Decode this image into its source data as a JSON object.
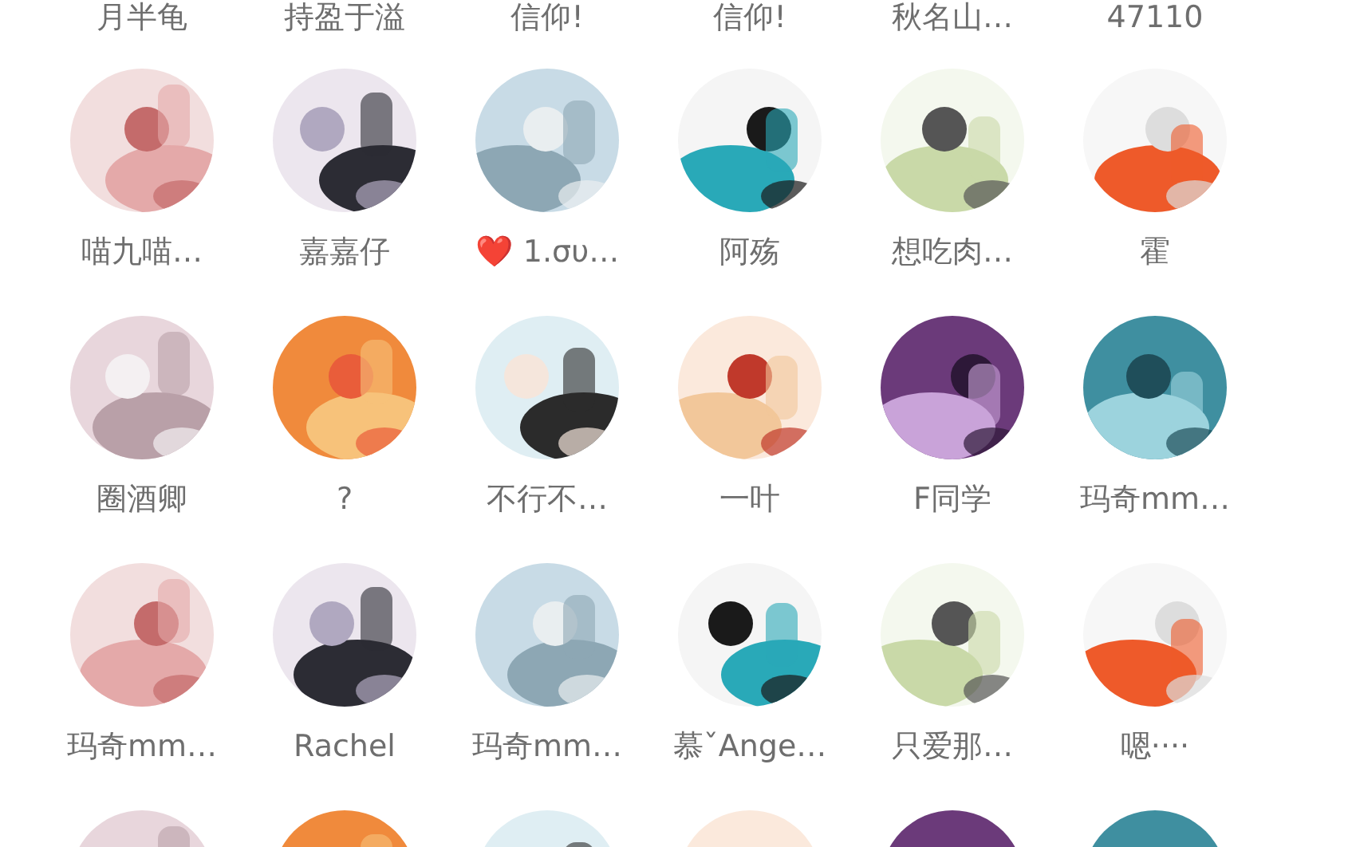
{
  "friends": [
    {
      "name": "月半龟"
    },
    {
      "name": "持盈于溢"
    },
    {
      "name": "信仰!"
    },
    {
      "name": "信仰!"
    },
    {
      "name": "秋名山…"
    },
    {
      "name": "47110"
    },
    {
      "name": "喵九喵…",
      "avatar": {
        "kind": "picture"
      }
    },
    {
      "name": "嘉嘉仔",
      "avatar": {
        "kind": "picture"
      }
    },
    {
      "name": "❤️ 1.συ…",
      "avatar": {
        "kind": "picture"
      }
    },
    {
      "name": "阿殇",
      "avatar": {
        "kind": "picture"
      }
    },
    {
      "name": "想吃肉…",
      "avatar": {
        "kind": "picture"
      }
    },
    {
      "name": "霍",
      "avatar": {
        "kind": "picture"
      }
    },
    {
      "name": "圈酒卿",
      "avatar": {
        "kind": "picture"
      }
    },
    {
      "name": "?",
      "avatar": {
        "kind": "picture"
      }
    },
    {
      "name": "不行不…",
      "avatar": {
        "kind": "picture"
      }
    },
    {
      "name": "一叶",
      "avatar": {
        "kind": "picture"
      }
    },
    {
      "name": "F同学",
      "avatar": {
        "kind": "picture"
      }
    },
    {
      "name": "玛奇mm…",
      "avatar": {
        "kind": "picture"
      }
    },
    {
      "name": "玛奇mm…",
      "avatar": {
        "kind": "picture"
      }
    },
    {
      "name": "Rachel",
      "avatar": {
        "kind": "picture"
      }
    },
    {
      "name": "玛奇mm…",
      "avatar": {
        "kind": "picture"
      }
    },
    {
      "name": "慕ˇAnge…",
      "avatar": {
        "kind": "picture"
      }
    },
    {
      "name": "只爱那…",
      "avatar": {
        "kind": "picture"
      }
    },
    {
      "name": "嗯····",
      "avatar": {
        "kind": "picture"
      }
    },
    {
      "avatar": {
        "kind": "picture"
      }
    },
    {
      "avatar": {
        "kind": "picture"
      }
    },
    {
      "avatar": {
        "kind": "picture"
      }
    },
    {
      "avatar": {
        "kind": "picture"
      }
    },
    {
      "avatar": {
        "kind": "picture"
      }
    },
    {
      "avatar": {
        "kind": "picture"
      }
    }
  ]
}
